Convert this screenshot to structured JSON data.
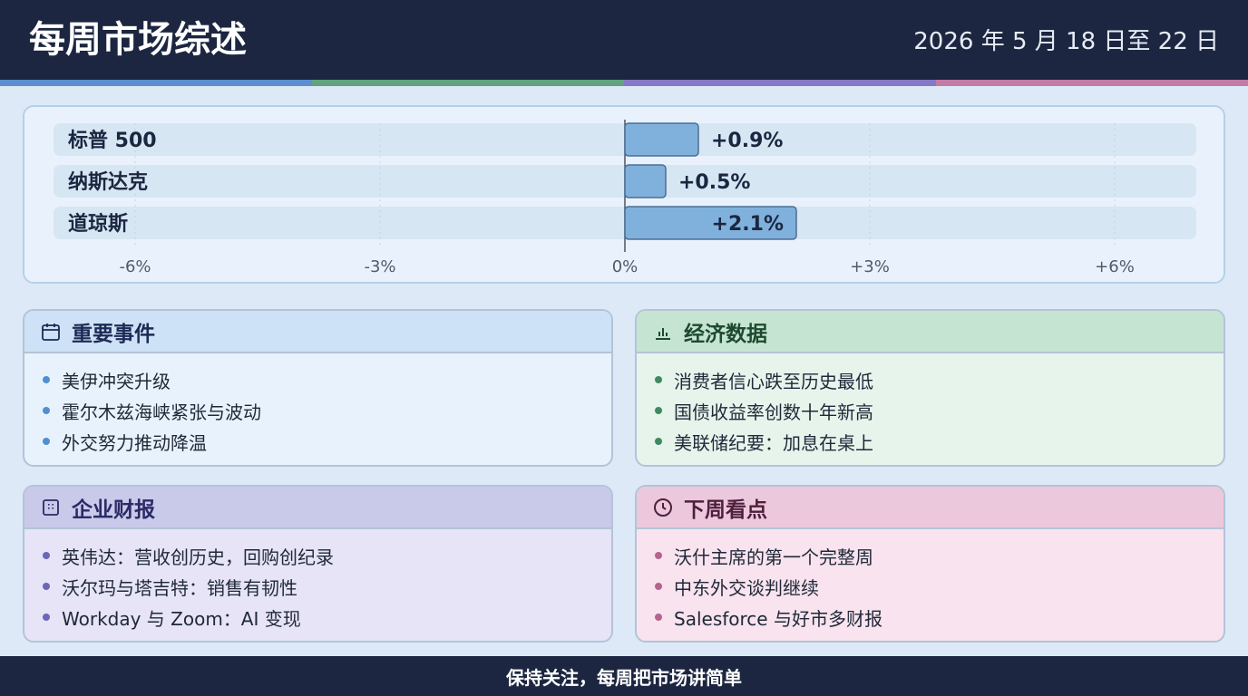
{
  "header": {
    "title": "每周市场综述",
    "date_range": "2026 年 5 月 18 日至 22 日"
  },
  "colors": {
    "navy": "#1c2640",
    "stripe": [
      "#5b8fd0",
      "#62a37d",
      "#8579c6",
      "#c27ba6"
    ],
    "bar_fill": "#7fb1dc",
    "bar_stroke": "#4d6f93"
  },
  "chart_data": {
    "type": "bar",
    "orientation": "horizontal",
    "categories": [
      "标普 500",
      "纳斯达克",
      "道琼斯"
    ],
    "values": [
      0.9,
      0.5,
      2.1
    ],
    "value_labels": [
      "+0.9%",
      "+0.5%",
      "+2.1%"
    ],
    "xlim": [
      -7,
      7
    ],
    "xticks": [
      -6,
      -3,
      0,
      3,
      6
    ],
    "xtick_labels": [
      "-6%",
      "-3%",
      "0%",
      "+3%",
      "+6%"
    ],
    "grid": true
  },
  "cards": [
    {
      "title": "重要事件",
      "icon": "calendar-icon",
      "head_bg": "#cde2f6",
      "body_bg": "#e8f2fc",
      "dot_color": "#4f8fcf",
      "title_color": "#1c2a55",
      "items": [
        "美伊冲突升级",
        "霍尔木兹海峡紧张与波动",
        "外交努力推动降温"
      ]
    },
    {
      "title": "经济数据",
      "icon": "bar-chart-icon",
      "head_bg": "#c6e4d2",
      "body_bg": "#e6f4ec",
      "dot_color": "#3f8a5f",
      "title_color": "#1d4a2f",
      "items": [
        "消费者信心跌至历史最低",
        "国债收益率创数十年新高",
        "美联储纪要：加息在桌上"
      ]
    },
    {
      "title": "企业财报",
      "icon": "building-icon",
      "head_bg": "#c9c9ea",
      "body_bg": "#e6e4f6",
      "dot_color": "#6a66b8",
      "title_color": "#2a2a66",
      "items": [
        "英伟达：营收创历史，回购创纪录",
        "沃尔玛与塔吉特：销售有韧性",
        "Workday 与 Zoom：AI 变现"
      ]
    },
    {
      "title": "下周看点",
      "icon": "clock-icon",
      "head_bg": "#ecc8dc",
      "body_bg": "#f8e3ee",
      "dot_color": "#b4648e",
      "title_color": "#4e1f3c",
      "items": [
        "沃什主席的第一个完整周",
        "中东外交谈判继续",
        "Salesforce 与好市多财报"
      ]
    }
  ],
  "footer": {
    "text": "保持关注，每周把市场讲简单"
  }
}
